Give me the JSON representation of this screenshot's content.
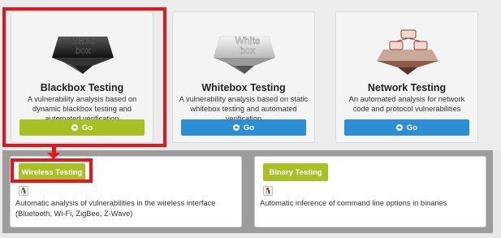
{
  "cards": [
    {
      "icon_label": "Black box",
      "icon_line1": "Black",
      "icon_line2": "box",
      "title": "Blackbox Testing",
      "desc": "A vulnerability analysis based on dynamic blackbox testing and automated verification",
      "button": "Go",
      "button_color": "#a7c125"
    },
    {
      "icon_label": "White box",
      "icon_line1": "White",
      "icon_line2": "box",
      "title": "Whitebox Testing",
      "desc": "A vulnerability analysis based on static whitebox testing and automated verification",
      "button": "Go",
      "button_color": "#2c8fd6"
    },
    {
      "title": "Network Testing",
      "desc": "An automated analysis for network code and protocol vulnerabilities",
      "button": "Go",
      "button_color": "#2c8fd6"
    }
  ],
  "subcards": [
    {
      "button": "Wireless Testing",
      "icon": "linux-icon",
      "desc": "Automatic analysis of vulnerabilities in the wireless interface (Bluetooth, Wi-Fi, ZigBee, Z-Wave)"
    },
    {
      "button": "Binary Testing",
      "icon": "linux-icon",
      "desc": "Automatic inference of command line options in binaries"
    }
  ],
  "highlight_color": "#e8131b"
}
